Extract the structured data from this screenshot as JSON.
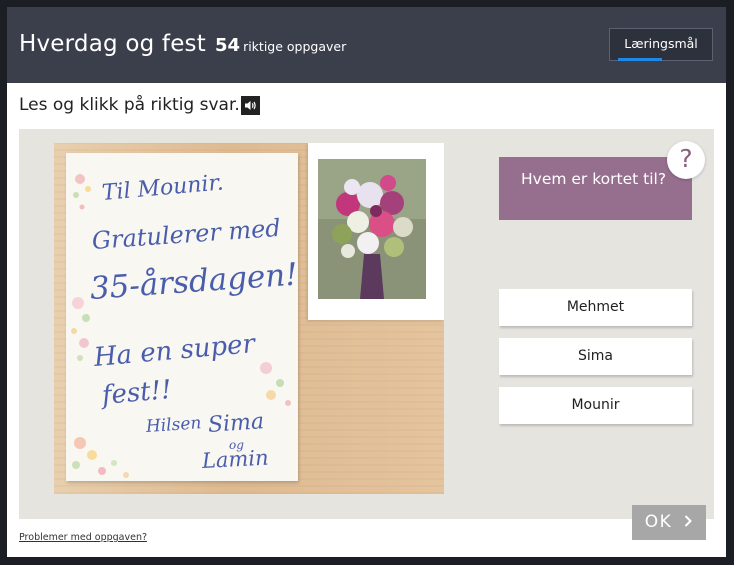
{
  "header": {
    "title": "Hverdag og fest",
    "count": "54",
    "count_label": "riktige oppgaver",
    "goals_label": "Læringsmål"
  },
  "instruction": "Les og klikk på riktig svar.",
  "card_text": {
    "line1": "Til Mounir.",
    "line2": "Gratulerer med",
    "line3": "35-årsdagen!",
    "line4": "Ha en super",
    "line5": "fest!!",
    "line6_a": "Hilsen",
    "line6_b": "Sima",
    "line7": "og",
    "line8": "Lamin"
  },
  "question": {
    "text": "Hvem er kortet til?",
    "help_symbol": "?"
  },
  "answers": [
    {
      "label": "Mehmet"
    },
    {
      "label": "Sima"
    },
    {
      "label": "Mounir"
    }
  ],
  "footer": {
    "problems_link": "Problemer med oppgaven?",
    "ok_label": "OK",
    "ok_icon": "chevron-right-icon"
  },
  "colors": {
    "header_bg": "#3a3f4b",
    "question_bg": "#966f8f",
    "accent_underline": "#1e88e5",
    "ok_bg": "#a7a7a7",
    "card_ink": "#4a5dab"
  }
}
